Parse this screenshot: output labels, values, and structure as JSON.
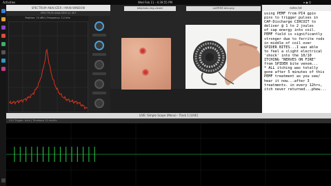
{
  "topbar": {
    "activities": "Activities",
    "datetime": "Wed Feb 11 - 4:39:55 PM"
  },
  "analyzer": {
    "title": "SPECTRUM ANALYZER / MAIN WINDOW",
    "subtitle": "SPECTRUM ANALYZER  A1  SET",
    "caption": "Position: 74 dBV  |  Frequency: 3.2 kHz"
  },
  "image_viewer": {
    "title": "bitephoto-img-viewer"
  },
  "photo_window": {
    "title": "coilPEMF-bite.png"
  },
  "text_editor": {
    "title": "notes.txt",
    "lines": [
      "using PEMF from PI4 gpio",
      "pins to trigger pulses in",
      "CAP-Discharge CIRCUIT to",
      "deliver @ 1 to 2 joules",
      "of cap energy into coil.",
      "PEMF field is significantly",
      "stronger due to ferrite rods",
      "in middle of coil over",
      "SPIDER BITES...I was able",
      "to feel a slight electrical",
      "'shock' into the 10/10",
      "ITCHING \"NERVES ON FIRE\"",
      "from SPIDER bite venom...",
      "* ALL itching was totally",
      "gone after 5 minutes of this",
      "PEMF treatment as you see/",
      "hear it now...after 3",
      "treatments. in every 12hrs,",
      "itch never returned...phew..."
    ]
  },
  "scope": {
    "title": "LIVE: Simple Scope (Mono) - Track 1 [LIVE]",
    "toolbar": "CH1  Trigger: Auto  |  Timebase 10 ms/div"
  },
  "colors": {
    "trace": "#27d34a",
    "spectrum": "#d9321f"
  }
}
